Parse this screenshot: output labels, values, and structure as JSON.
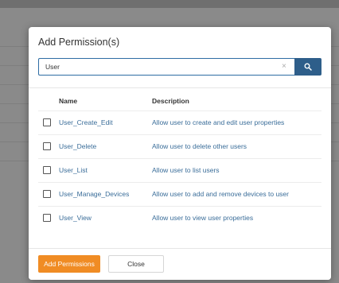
{
  "dialog": {
    "title": "Add Permission(s)"
  },
  "search": {
    "value": "User",
    "placeholder": "",
    "clear_icon": "×",
    "button_icon": "search-icon"
  },
  "table": {
    "columns": [
      "Name",
      "Description"
    ],
    "rows": [
      {
        "name": "User_Create_Edit",
        "description": "Allow user to create and edit user properties"
      },
      {
        "name": "User_Delete",
        "description": "Allow user to delete other users"
      },
      {
        "name": "User_List",
        "description": "Allow user to list users"
      },
      {
        "name": "User_Manage_Devices",
        "description": "Allow user to add and remove devices to user"
      },
      {
        "name": "User_View",
        "description": "Allow user to view user properties"
      }
    ]
  },
  "footer": {
    "primary_label": "Add Permissions",
    "secondary_label": "Close"
  },
  "colors": {
    "primary_button": "#f08c24",
    "search_button": "#2e5e8a",
    "link_text": "#3a6d99"
  }
}
